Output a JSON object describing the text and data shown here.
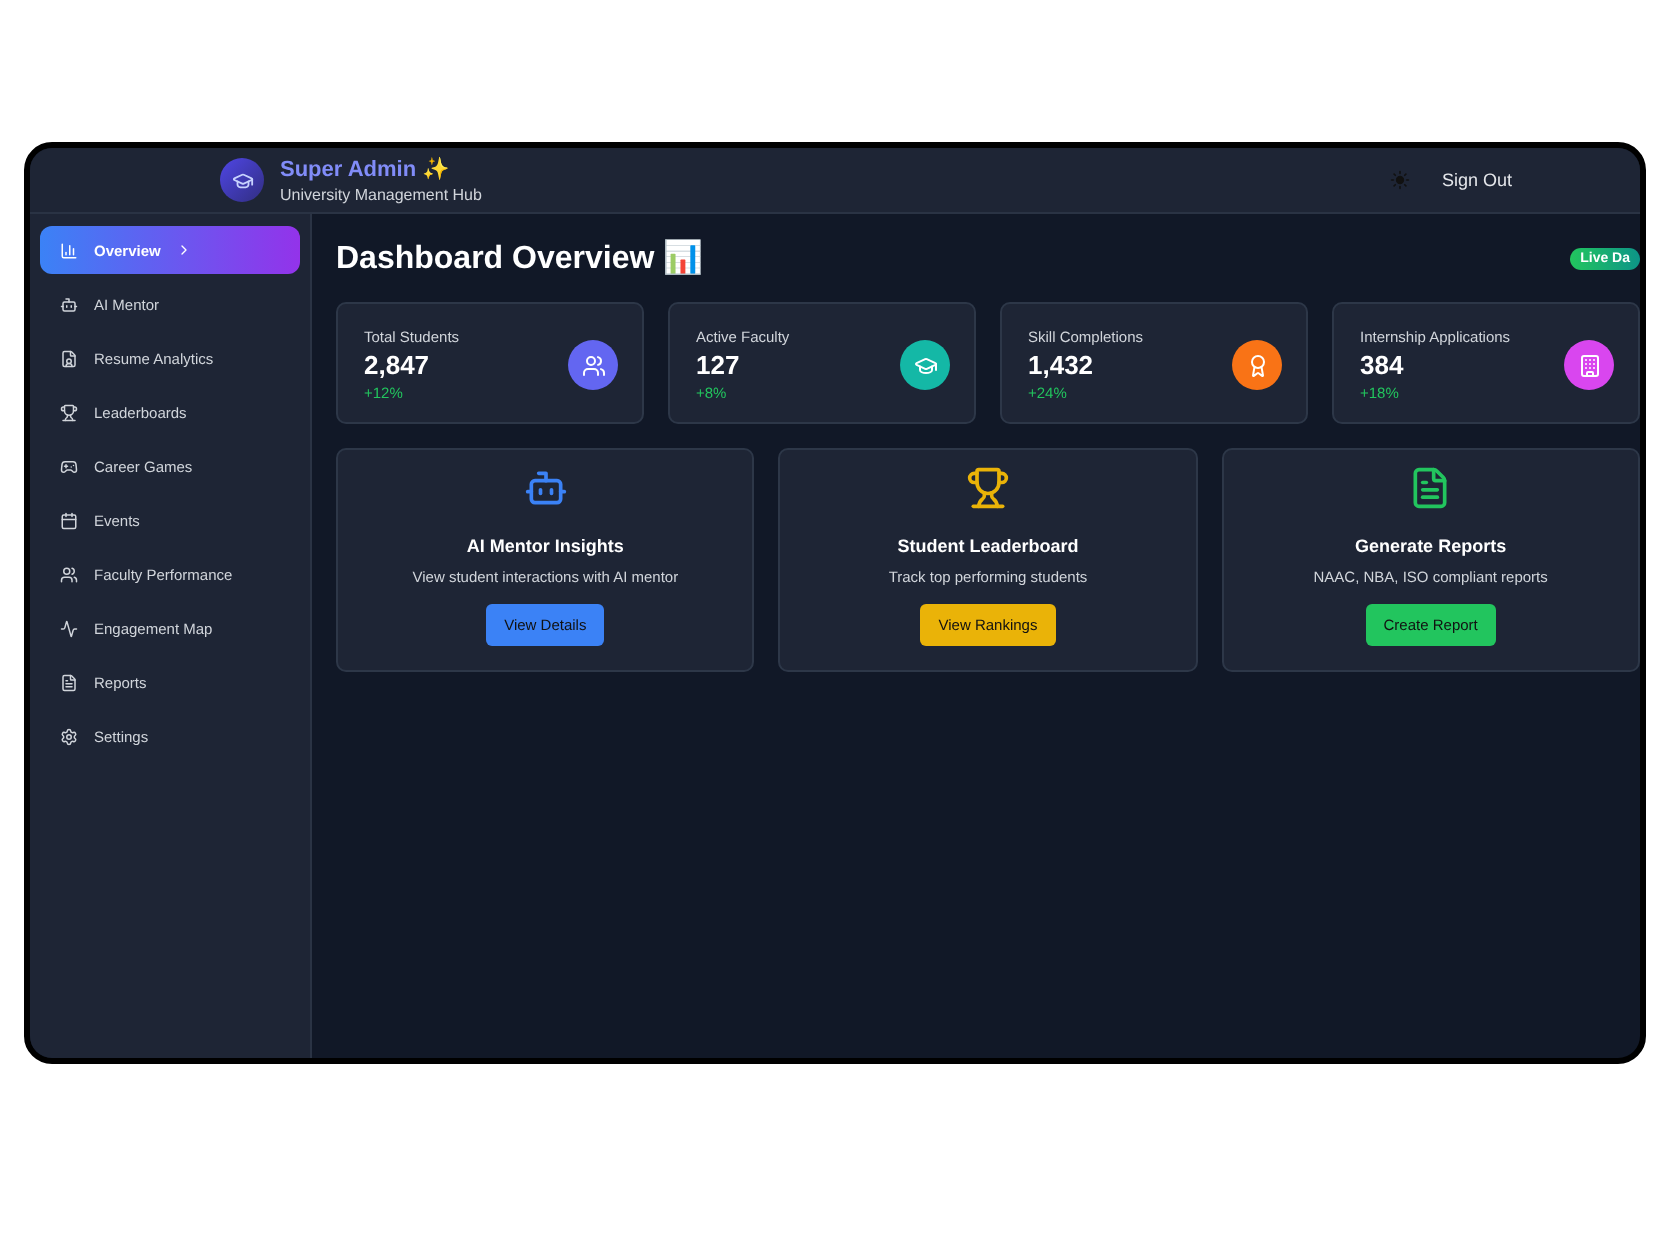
{
  "header": {
    "title": "Super Admin ✨",
    "subtitle": "University Management Hub",
    "sign_out": "Sign Out"
  },
  "sidebar": {
    "items": [
      {
        "label": "Overview",
        "selected": true
      },
      {
        "label": "AI Mentor",
        "selected": false
      },
      {
        "label": "Resume Analytics",
        "selected": false
      },
      {
        "label": "Leaderboards",
        "selected": false
      },
      {
        "label": "Career Games",
        "selected": false
      },
      {
        "label": "Events",
        "selected": false
      },
      {
        "label": "Faculty Performance",
        "selected": false
      },
      {
        "label": "Engagement Map",
        "selected": false
      },
      {
        "label": "Reports",
        "selected": false
      },
      {
        "label": "Settings",
        "selected": false
      }
    ]
  },
  "main": {
    "title": "Dashboard Overview 📊",
    "badge": "Live Da",
    "stats": [
      {
        "label": "Total Students",
        "value": "2,847",
        "change": "+12%",
        "color": "#6366f1"
      },
      {
        "label": "Active Faculty",
        "value": "127",
        "change": "+8%",
        "color": "#14b8a6"
      },
      {
        "label": "Skill Completions",
        "value": "1,432",
        "change": "+24%",
        "color": "#f97316"
      },
      {
        "label": "Internship Applications",
        "value": "384",
        "change": "+18%",
        "color": "#d946ef"
      }
    ],
    "features": [
      {
        "title": "AI Mentor Insights",
        "description": "View student interactions with AI mentor",
        "button": "View Details",
        "color": "#3b82f6"
      },
      {
        "title": "Student Leaderboard",
        "description": "Track top performing students",
        "button": "View Rankings",
        "color": "#eab308"
      },
      {
        "title": "Generate Reports",
        "description": "NAAC, NBA, ISO compliant reports",
        "button": "Create Report",
        "color": "#22c55e"
      }
    ]
  }
}
